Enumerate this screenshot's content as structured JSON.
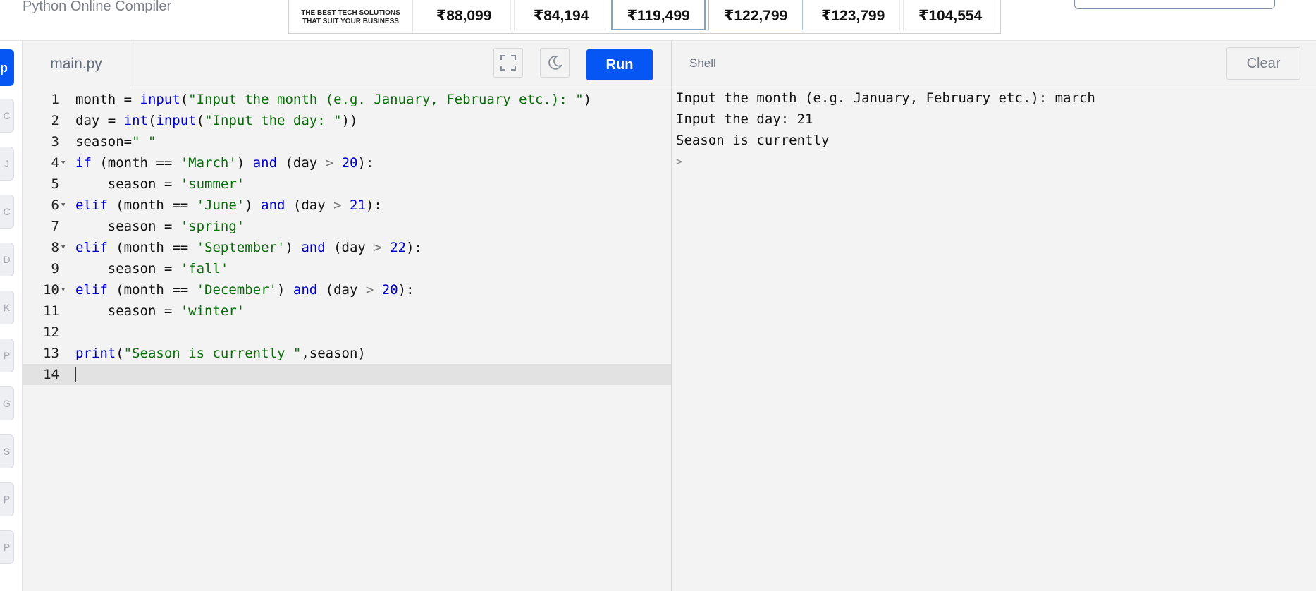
{
  "header": {
    "app_title": "Python Online Compiler",
    "ad": {
      "slogan": "THE BEST TECH SOLUTIONS THAT SUIT YOUR BUSINESS",
      "prices": [
        "₹88,099",
        "₹84,194",
        "₹119,499",
        "₹122,799",
        "₹123,799",
        "₹104,554"
      ]
    }
  },
  "sidebar": {
    "active_label": "p",
    "items": [
      "C",
      "J",
      "C",
      "D",
      "K",
      "P",
      "G",
      "S",
      "P",
      "P"
    ]
  },
  "editor": {
    "file_tab": "main.py",
    "run_label": "Run",
    "fullscreen_icon": "expand-icon",
    "theme_icon": "moon-icon",
    "active_line": 14,
    "lines": [
      "month = input(\"Input the month (e.g. January, February etc.): \")",
      "day = int(input(\"Input the day: \"))",
      "season=\" \"",
      "if (month == 'March') and (day > 20):",
      "    season = 'summer'",
      "elif (month == 'June') and (day > 21):",
      "    season = 'spring'",
      "elif (month == 'September') and (day > 22):",
      "    season = 'fall'",
      "elif (month == 'December') and (day > 20):",
      "    season = 'winter'",
      "",
      "print(\"Season is currently \",season)",
      ""
    ],
    "foldable_lines": [
      4,
      6,
      8,
      10
    ]
  },
  "shell": {
    "label": "Shell",
    "clear_label": "Clear",
    "output": [
      "Input the month (e.g. January, February etc.): march",
      "Input the day: 21",
      "Season is currently"
    ],
    "prompt": ">"
  },
  "colors": {
    "accent": "#0556f3",
    "keyword": "#0000cc",
    "string": "#0a6b0a",
    "background": "#f3f3f3"
  }
}
